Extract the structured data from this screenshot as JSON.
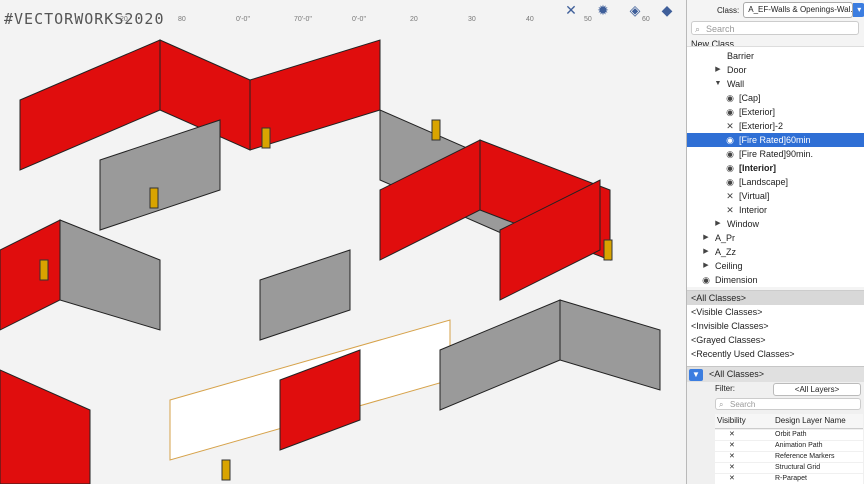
{
  "watermark": "#VECTORWORKS2020",
  "ruler_ticks": [
    "20",
    "80",
    "0'-0\"",
    "70'-0\"",
    "0'-0\"",
    "20",
    "30",
    "40",
    "50",
    "60"
  ],
  "toolbar": {
    "icons": [
      "snap-icon",
      "settings-gear-icon",
      "render-mode-icon",
      "view-mode-icon"
    ],
    "glyphs": [
      "✕",
      "✹",
      "◈",
      "◆"
    ]
  },
  "class_panel": {
    "label": "Class:",
    "selected_class": "A_EF-Walls & Openings-Wal...",
    "search_placeholder": "Search",
    "new_class": "New Class...",
    "tree": [
      {
        "label": "Barrier",
        "indent": 2,
        "twisty": "",
        "icon": ""
      },
      {
        "label": "Door",
        "indent": 2,
        "twisty": "▶",
        "icon": ""
      },
      {
        "label": "Wall",
        "indent": 2,
        "twisty": "▼",
        "icon": ""
      },
      {
        "label": "[Cap]",
        "indent": 3,
        "twisty": "",
        "icon": "eye"
      },
      {
        "label": "[Exterior]",
        "indent": 3,
        "twisty": "",
        "icon": "eye"
      },
      {
        "label": "[Exterior]-2",
        "indent": 3,
        "twisty": "",
        "icon": "x"
      },
      {
        "label": "[Fire Rated]60min",
        "indent": 3,
        "twisty": "",
        "icon": "eye",
        "selected": true
      },
      {
        "label": "[Fire Rated]90min.",
        "indent": 3,
        "twisty": "",
        "icon": "eye"
      },
      {
        "label": "[Interior]",
        "indent": 3,
        "twisty": "",
        "icon": "eye",
        "bold": true
      },
      {
        "label": "[Landscape]",
        "indent": 3,
        "twisty": "",
        "icon": "eye"
      },
      {
        "label": "[Virtual]",
        "indent": 3,
        "twisty": "",
        "icon": "x"
      },
      {
        "label": "Interior",
        "indent": 3,
        "twisty": "",
        "icon": "x"
      },
      {
        "label": "Window",
        "indent": 2,
        "twisty": "▶",
        "icon": ""
      },
      {
        "label": "A_Pr",
        "indent": 1,
        "twisty": "▶",
        "icon": ""
      },
      {
        "label": "A_Zz",
        "indent": 1,
        "twisty": "▶",
        "icon": ""
      },
      {
        "label": "Ceiling",
        "indent": 1,
        "twisty": "▶",
        "icon": ""
      },
      {
        "label": "Dimension",
        "indent": 1,
        "twisty": "",
        "icon": "eye"
      }
    ],
    "filters": [
      "<All Classes>",
      "<Visible Classes>",
      "<Invisible Classes>",
      "<Grayed Classes>",
      "<Recently Used Classes>"
    ],
    "filter_bar_label": "<All Classes>"
  },
  "layers_panel": {
    "filter_label": "Filter:",
    "filter_value": "<All Layers>",
    "search_placeholder": "Search",
    "col_visibility": "Visibility",
    "col_name": "Design Layer Name",
    "rows": [
      {
        "vis": "✕",
        "name": "Orbit Path"
      },
      {
        "vis": "✕",
        "name": "Animation Path"
      },
      {
        "vis": "✕",
        "name": "Reference Markers"
      },
      {
        "vis": "✕",
        "name": "Structural Grid"
      },
      {
        "vis": "✕",
        "name": "R-Parapet"
      }
    ]
  },
  "colors": {
    "wall_fire": "#e00d0d",
    "wall_gray": "#9a9a9a",
    "selection": "#2f6fd5",
    "accent": "#3b7de0",
    "door": "#d9a400"
  }
}
